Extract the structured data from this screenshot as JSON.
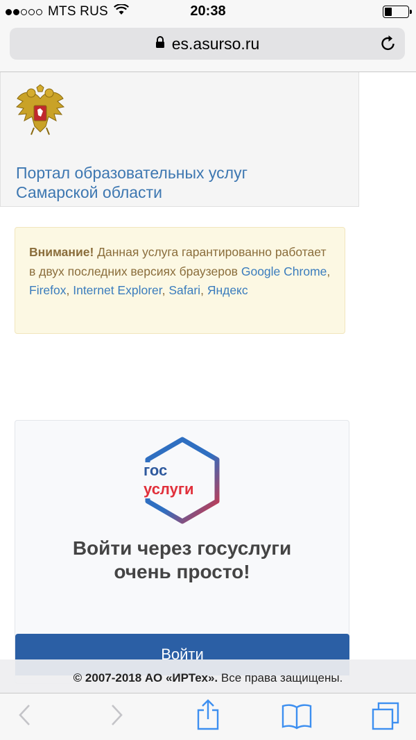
{
  "status_bar": {
    "carrier": "MTS RUS",
    "time": "20:38",
    "signal_bars_filled": 2,
    "signal_bars_total": 5
  },
  "browser": {
    "url": "es.asurso.ru"
  },
  "header": {
    "title_line1": "Портал образовательных услуг",
    "title_line2": "Самарской области"
  },
  "alert": {
    "bold_label": "Внимание!",
    "text": "Данная услуга гарантированно работает в двух последних версиях браузеров",
    "browsers": [
      "Google Chrome",
      "Firefox",
      "Internet Explorer",
      "Safari",
      "Яндекс"
    ]
  },
  "gosuslugi": {
    "logo_line1": "гос",
    "logo_line2": "услуги",
    "text": "Войти через госуслуги очень просто!",
    "button_label": "Войти"
  },
  "footer": {
    "copyright": "© 2007-2018 АО",
    "company": "«ИРТех».",
    "rights": "Все права защищены."
  },
  "colors": {
    "link": "#3d77b1",
    "button": "#2b5fa5",
    "alert_bg": "#fcf8e3",
    "alert_text": "#8a6d3b",
    "ios_blue": "#3d8ff0"
  }
}
